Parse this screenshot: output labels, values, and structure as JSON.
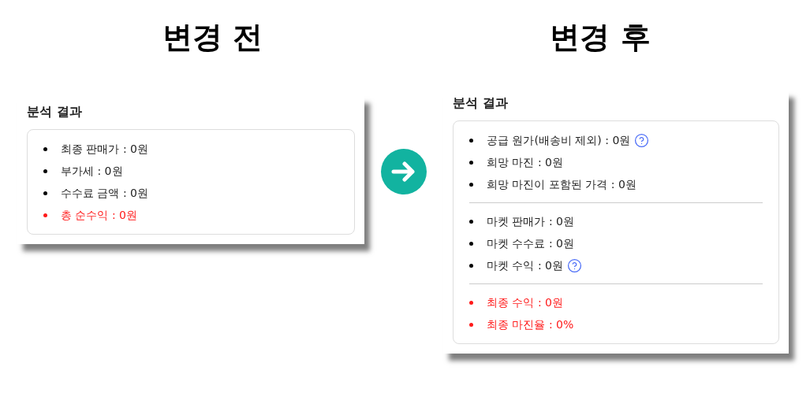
{
  "panels": [
    {
      "heading": "변경 전",
      "title": "분석 결과",
      "groups": [
        [
          {
            "text": "최종 판매가 : 0원",
            "emphasis": false,
            "help": false
          },
          {
            "text": "부가세 : 0원",
            "emphasis": false,
            "help": false
          },
          {
            "text": "수수료 금액 : 0원",
            "emphasis": false,
            "help": false
          },
          {
            "text": "총 순수익 : 0원",
            "emphasis": true,
            "help": false
          }
        ]
      ]
    },
    {
      "heading": "변경 후",
      "title": "분석 결과",
      "groups": [
        [
          {
            "text": "공급 원가(배송비 제외) : 0원",
            "emphasis": false,
            "help": true
          },
          {
            "text": "희망 마진 : 0원",
            "emphasis": false,
            "help": false
          },
          {
            "text": "희망 마진이 포함된 가격 : 0원",
            "emphasis": false,
            "help": false
          }
        ],
        [
          {
            "text": "마켓 판매가 : 0원",
            "emphasis": false,
            "help": false
          },
          {
            "text": "마켓 수수료 : 0원",
            "emphasis": false,
            "help": false
          },
          {
            "text": "마켓 수익 : 0원",
            "emphasis": false,
            "help": true
          }
        ],
        [
          {
            "text": "최종 수익 : 0원",
            "emphasis": true,
            "help": false
          },
          {
            "text": "최종 마진율 : 0%",
            "emphasis": true,
            "help": false
          }
        ]
      ]
    }
  ]
}
